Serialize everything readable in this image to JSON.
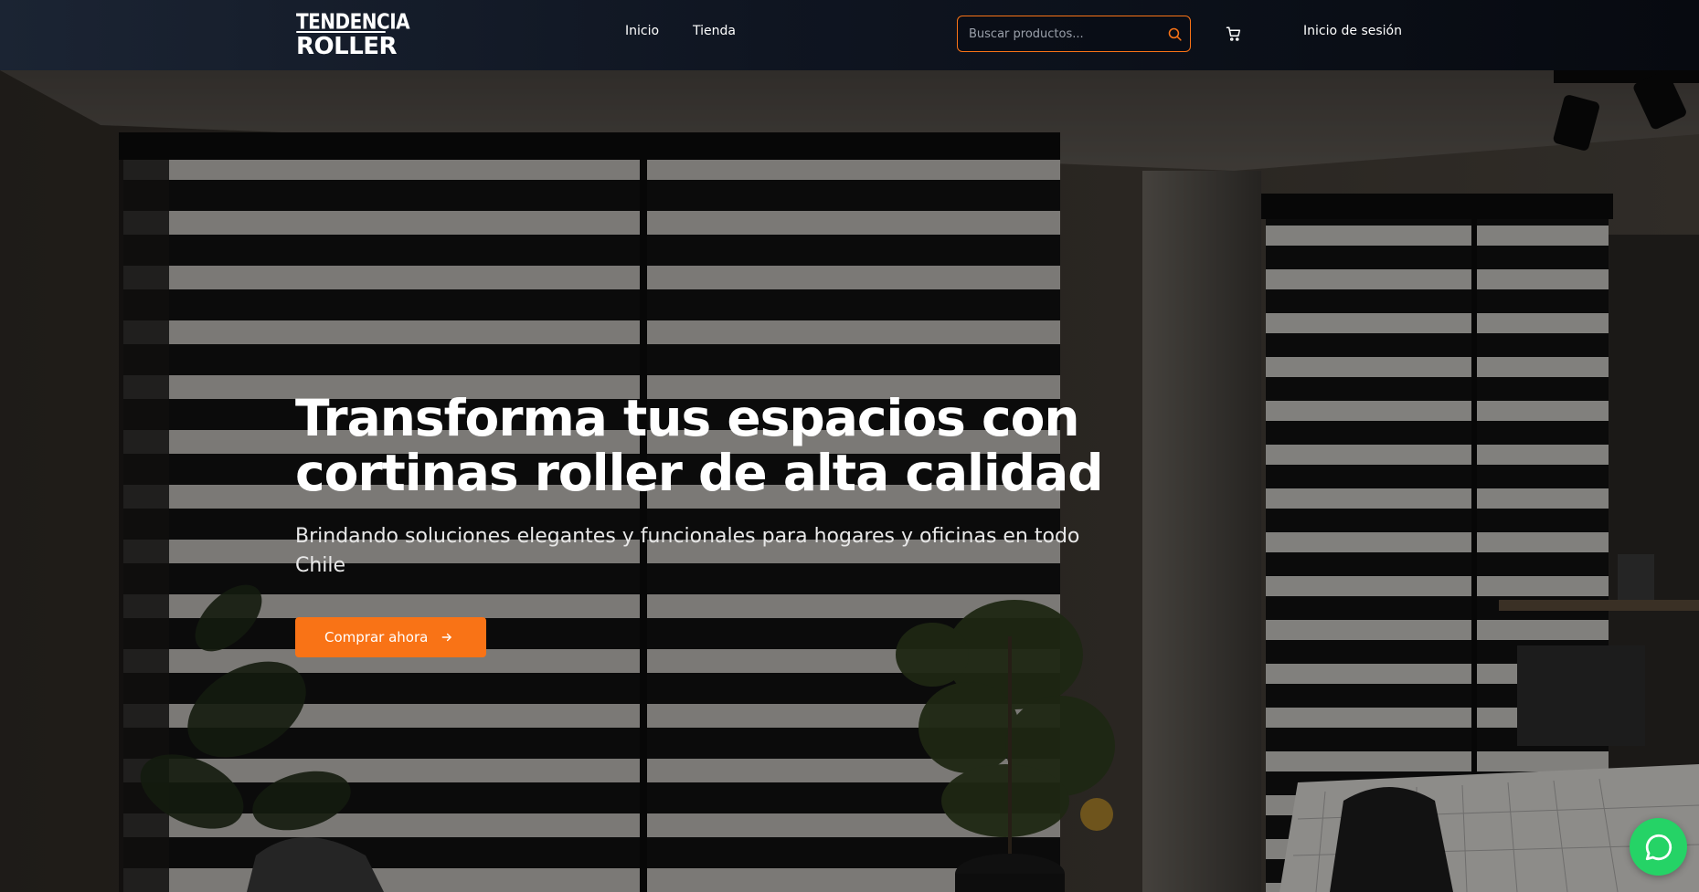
{
  "header": {
    "logo": {
      "line1": "TENDENCIA",
      "line2": "ROLLER"
    },
    "nav": [
      {
        "label": "Inicio"
      },
      {
        "label": "Tienda"
      }
    ],
    "search": {
      "placeholder": "Buscar productos...",
      "value": ""
    },
    "login_label": "Inicio de sesión"
  },
  "hero": {
    "title": "Transforma tus espacios con cortinas roller de alta calidad",
    "subtitle": "Brindando soluciones elegantes y funcionales para hogares y oficinas en todo Chile",
    "cta_label": "Comprar ahora"
  },
  "colors": {
    "accent": "#f97316",
    "header_bg": "#0f1521",
    "whatsapp": "#25d366"
  },
  "icons": [
    "search-icon",
    "cart-icon",
    "arrow-right-icon",
    "whatsapp-icon"
  ]
}
